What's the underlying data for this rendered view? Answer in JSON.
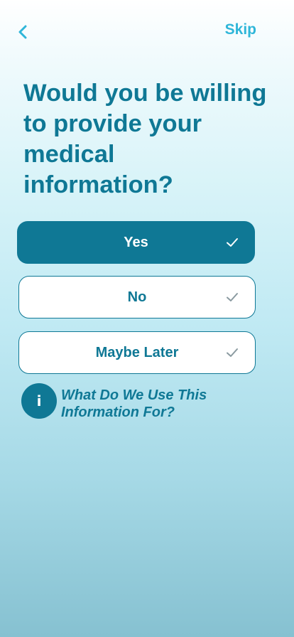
{
  "header": {
    "back_icon": "chevron-left-icon",
    "skip_label": "Skip"
  },
  "question": {
    "title": "Would you be willing to provide your medical information?"
  },
  "options": [
    {
      "label": "Yes",
      "selected": true
    },
    {
      "label": "No",
      "selected": false
    },
    {
      "label": "Maybe Later",
      "selected": false
    }
  ],
  "info": {
    "icon_letter": "i",
    "link_text": "What Do We Use This Information For?"
  },
  "colors": {
    "primary": "#0f7895",
    "accent": "#2fb6d9",
    "unselected_check": "#8a9aa0"
  }
}
